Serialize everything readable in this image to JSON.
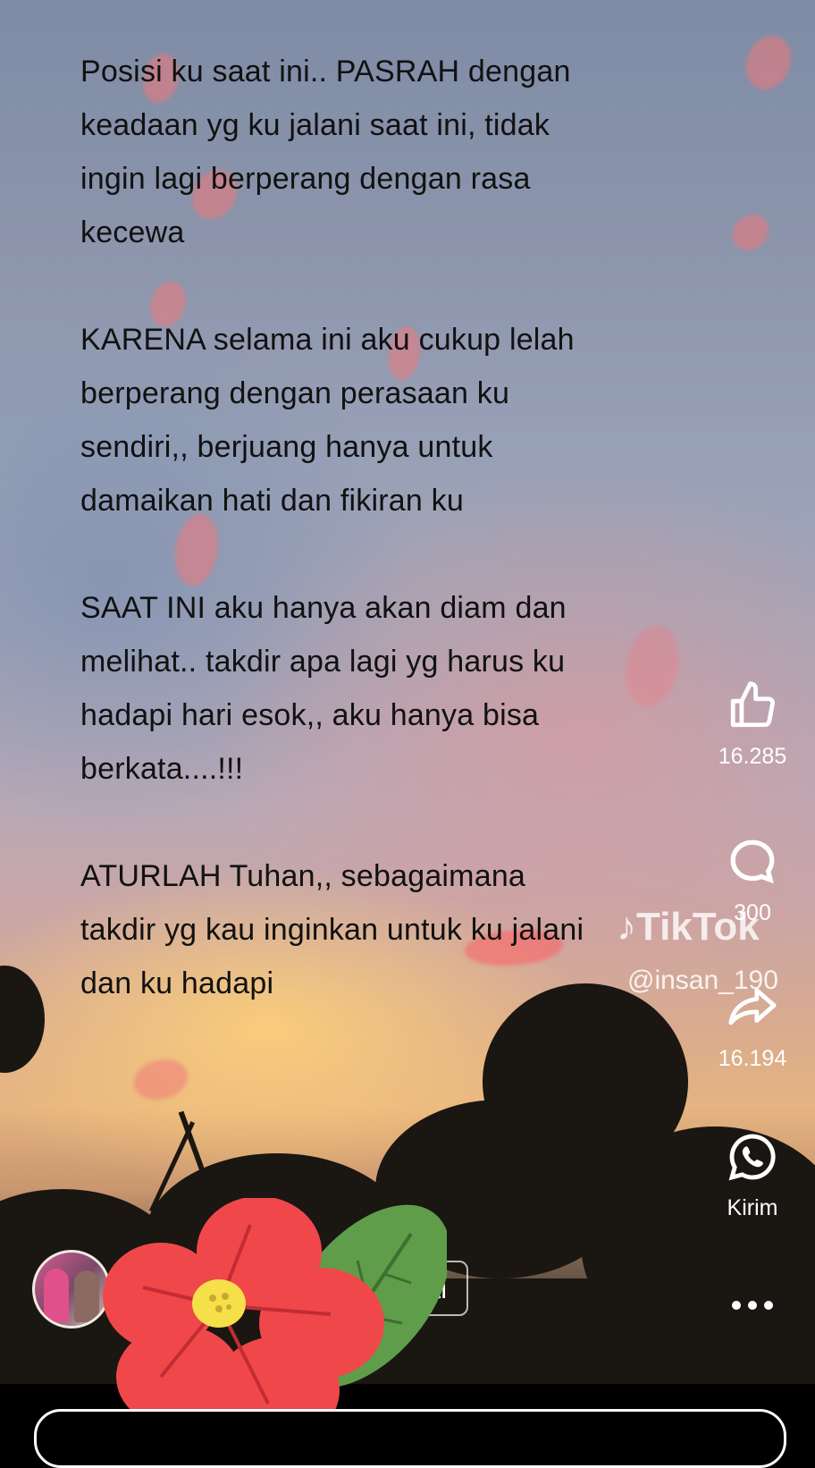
{
  "post": {
    "paragraphs": [
      [
        "Posisi ku saat ini.. PASRAH dengan",
        "keadaan yg ku jalani saat ini, tidak",
        "ingin lagi berperang dengan rasa",
        "kecewa"
      ],
      [
        "KARENA selama ini aku cukup lelah",
        "berperang dengan perasaan ku",
        "sendiri,, berjuang hanya untuk",
        "damaikan hati dan fikiran ku"
      ],
      [
        "SAAT INI aku hanya akan diam dan",
        "melihat.. takdir apa lagi yg harus ku",
        "hadapi hari esok,, aku hanya bisa",
        "berkata....!!!"
      ],
      [
        "ATURLAH Tuhan,, sebagaimana",
        "takdir yg kau inginkan untuk ku jalani",
        "dan ku hadapi"
      ]
    ]
  },
  "actions": {
    "likes": "16.285",
    "comments": "300",
    "shares": "16.194",
    "send_label": "Kirim",
    "like_icon": "thumbs-up-icon",
    "comment_icon": "comment-bubble-icon",
    "share_icon": "share-arrow-icon",
    "whatsapp_icon": "whatsapp-icon",
    "more_icon": "more-dots-icon"
  },
  "watermark": {
    "brand": "TikTok",
    "handle": "@insan_190"
  },
  "follow": {
    "label": "ti"
  },
  "colors": {
    "text": "#111111",
    "overlay_text": "#ffffff",
    "sticker_petal": "#f0484a",
    "sticker_leaf": "#5f9d4a"
  }
}
